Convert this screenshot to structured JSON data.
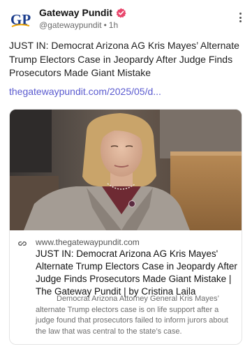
{
  "account": {
    "name": "Gateway Pundit",
    "handle": "@gatewaypundit",
    "separator": "•",
    "time": "1h",
    "avatar_text": "GP",
    "verified_color": "#e8466c",
    "avatar_color": "#1a3c8c",
    "avatar_accent": "#f0a500"
  },
  "post": {
    "text": "JUST IN: Democrat Arizona AG Kris Mayes’ Alternate Trump Electors Case in Jeopardy After Judge Finds Prosecutors Made Giant Mistake",
    "link": "thegatewaypundit.com/2025/05/d..."
  },
  "card": {
    "domain": "www.thegatewaypundit.com",
    "title": "JUST IN: Democrat Arizona AG Kris Mayes' Alternate Trump Electors Case in Jeopardy After Judge Finds Prosecutors Made Giant Mistake | The Gateway Pundit | by Cristina Laila",
    "description": "Democrat Arizona Attorney General Kris Mayes’ alternate Trump electors case is on life support after a judge found that prosecutors failed to inform jurors about the law that was central to the state’s case."
  },
  "icons": {
    "verified": "verified-badge-icon",
    "more": "more-options-icon",
    "link": "link-icon"
  }
}
